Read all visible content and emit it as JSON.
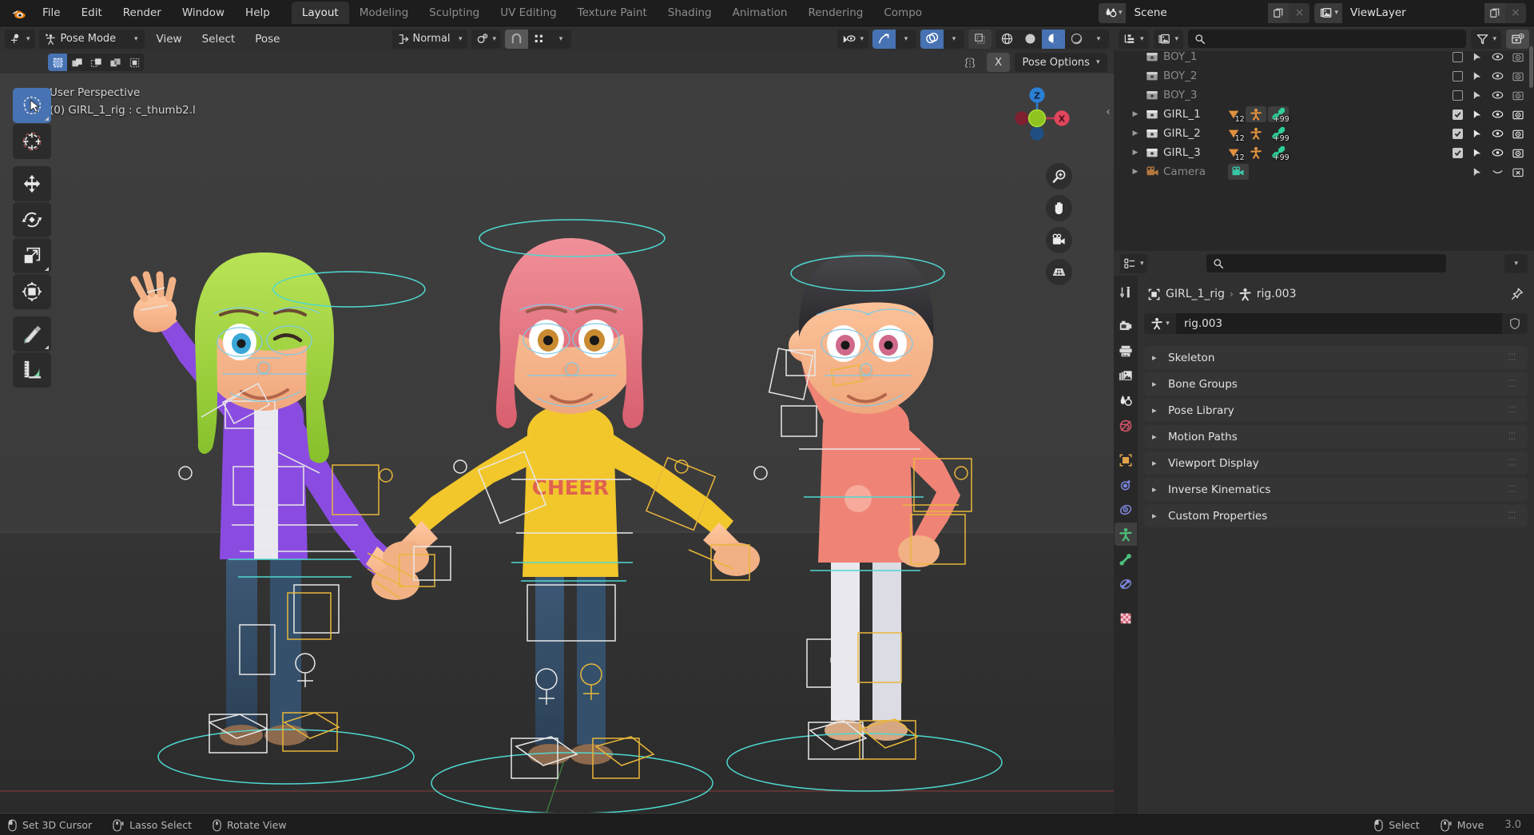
{
  "app": {
    "name": "Blender",
    "version": "3.0"
  },
  "topbar": {
    "menus": [
      "File",
      "Edit",
      "Render",
      "Window",
      "Help"
    ],
    "workspaces": [
      {
        "label": "Layout",
        "active": true
      },
      {
        "label": "Modeling",
        "active": false
      },
      {
        "label": "Sculpting",
        "active": false
      },
      {
        "label": "UV Editing",
        "active": false
      },
      {
        "label": "Texture Paint",
        "active": false
      },
      {
        "label": "Shading",
        "active": false
      },
      {
        "label": "Animation",
        "active": false
      },
      {
        "label": "Rendering",
        "active": false
      },
      {
        "label": "Compo",
        "active": false
      }
    ],
    "scene": {
      "name": "Scene",
      "icon": "scene-icon",
      "new_label": "",
      "x_label": "×"
    },
    "viewlayer": {
      "name": "ViewLayer",
      "icon": "viewlayer-icon",
      "x_label": "×"
    }
  },
  "viewport_header": {
    "editor_type_icon": "editor-type-icon",
    "mode": "Pose Mode",
    "menus": [
      "View",
      "Select",
      "Pose"
    ],
    "transform_orientation": "Normal",
    "pivot_icon": "pivot-point-icon",
    "snap_icon": "magnet-icon",
    "snap_target_icon": "snap-target-icon",
    "proportional_icon": "proportional-edit-icon",
    "visibility_icon": "object-visibility-icon",
    "gizmo_icon": "gizmo-icon",
    "overlays_icon": "overlays-icon",
    "xray_icon": "xray-icon",
    "shading": [
      "wireframe",
      "solid",
      "material-preview",
      "rendered"
    ],
    "shading_active": "material-preview"
  },
  "viewport_subheader": {
    "select_modes": [
      "set",
      "extend",
      "subtract",
      "invert",
      "intersect"
    ],
    "select_mode_active": 0,
    "symmetry_label": "X",
    "pose_options": "Pose Options"
  },
  "viewport": {
    "perspective_label": "User Perspective",
    "object_label": "(0) GIRL_1_rig : c_thumb2.l",
    "gizmo_axes": [
      {
        "name": "Z",
        "label": "Z",
        "color": "#2b7fd4"
      },
      {
        "name": "X",
        "label": "X",
        "color": "#d6374b"
      },
      {
        "name": "Y",
        "label": "",
        "color": "#8fc31f"
      }
    ],
    "nav_buttons": [
      "zoom-icon",
      "pan-hand-icon",
      "camera-view-icon",
      "toggle-perspective-icon"
    ],
    "tools": [
      {
        "name": "tweak-select-box-tool",
        "icon": "cursor-select-icon",
        "active": true
      },
      {
        "name": "cursor-tool",
        "icon": "3d-cursor-icon",
        "active": false
      },
      {
        "name": "move-tool",
        "icon": "move-arrows-icon",
        "active": false
      },
      {
        "name": "rotate-tool",
        "icon": "rotate-icon",
        "active": false
      },
      {
        "name": "scale-tool",
        "icon": "scale-icon",
        "active": false
      },
      {
        "name": "transform-tool",
        "icon": "transform-icon",
        "active": false
      },
      {
        "name": "annotate-tool",
        "icon": "pencil-icon",
        "active": false
      },
      {
        "name": "measure-tool",
        "icon": "ruler-icon",
        "active": false
      }
    ]
  },
  "outliner": {
    "display_mode_icon": "outliner-display-mode-icon",
    "filter_id_icon": "id-type-filter-icon",
    "search_placeholder": "",
    "search_value": "",
    "filter_icon": "funnel-icon",
    "new_collection_icon": "new-collection-icon",
    "rows": [
      {
        "name": "BOY_1",
        "dim": true,
        "expandable": false,
        "checkbox": "off",
        "badges": [],
        "rightmost": "camera"
      },
      {
        "name": "BOY_2",
        "dim": true,
        "expandable": false,
        "checkbox": "off",
        "badges": [],
        "rightmost": "camera"
      },
      {
        "name": "BOY_3",
        "dim": true,
        "expandable": false,
        "checkbox": "off",
        "badges": [],
        "rightmost": "camera"
      },
      {
        "name": "GIRL_1",
        "dim": false,
        "expandable": true,
        "checkbox": "on",
        "badges": [
          {
            "icon": "mesh-data-icon",
            "count": "12",
            "hl": false
          },
          {
            "icon": "armature-icon",
            "count": "",
            "hl": true
          },
          {
            "icon": "bone-icon",
            "count": "+99",
            "hl": true
          }
        ],
        "rightmost": "camera"
      },
      {
        "name": "GIRL_2",
        "dim": false,
        "expandable": true,
        "checkbox": "on",
        "badges": [
          {
            "icon": "mesh-data-icon",
            "count": "12",
            "hl": false
          },
          {
            "icon": "armature-icon",
            "count": "",
            "hl": false
          },
          {
            "icon": "bone-icon",
            "count": "+99",
            "hl": false
          }
        ],
        "rightmost": "camera"
      },
      {
        "name": "GIRL_3",
        "dim": false,
        "expandable": true,
        "checkbox": "on",
        "badges": [
          {
            "icon": "mesh-data-icon",
            "count": "12",
            "hl": false
          },
          {
            "icon": "armature-icon",
            "count": "",
            "hl": false
          },
          {
            "icon": "bone-icon",
            "count": "+99",
            "hl": false
          }
        ],
        "rightmost": "camera"
      },
      {
        "name": "Camera",
        "dim": true,
        "expandable": true,
        "checkbox": "none",
        "badges": [
          {
            "icon": "camera-data-icon",
            "count": "",
            "hl": true
          }
        ],
        "rightmost": "camera-off"
      }
    ]
  },
  "properties": {
    "editor_icon": "properties-editor-icon",
    "search_placeholder": "",
    "search_value": "",
    "breadcrumb": {
      "object_icon": "object-icon",
      "object": "GIRL_1_rig",
      "separator": "›",
      "data_icon": "armature-data-icon",
      "data": "rig.003",
      "pin_icon": "pin-icon"
    },
    "datablock": {
      "icon": "armature-data-icon",
      "name": "rig.003",
      "shield_icon": "fake-user-shield-icon"
    },
    "tabs": [
      {
        "name": "tool-tab",
        "icon": "tool-icon",
        "active": false,
        "color": "#d8d8d8"
      },
      {
        "name": "render-tab",
        "icon": "render-camera-icon",
        "active": false,
        "color": "#d8d8d8"
      },
      {
        "name": "output-tab",
        "icon": "printer-icon",
        "active": false,
        "color": "#d8d8d8"
      },
      {
        "name": "view-layer-tab",
        "icon": "images-icon",
        "active": false,
        "color": "#d8d8d8"
      },
      {
        "name": "scene-tab",
        "icon": "scene-cone-icon",
        "active": false,
        "color": "#d8d8d8"
      },
      {
        "name": "world-tab",
        "icon": "world-globe-icon",
        "active": false,
        "color": "#d4536a"
      },
      {
        "name": "object-tab",
        "icon": "object-square-icon",
        "active": false,
        "color": "#e0a24a"
      },
      {
        "name": "modifiers-tab",
        "icon": "physics-orbit-icon",
        "active": false,
        "color": "#7b85d8"
      },
      {
        "name": "constraints-tab",
        "icon": "constraint-icon",
        "active": false,
        "color": "#7b85d8"
      },
      {
        "name": "object-data-tab",
        "icon": "armature-data-icon",
        "active": true,
        "color": "#4ec07c"
      },
      {
        "name": "bone-tab",
        "icon": "bone-icon",
        "active": false,
        "color": "#4ec07c"
      },
      {
        "name": "bone-constraint-tab",
        "icon": "bone-constraint-icon",
        "active": false,
        "color": "#7b85d8"
      },
      {
        "name": "texture-tab",
        "icon": "checker-texture-icon",
        "active": false,
        "color": "#d4687a"
      }
    ],
    "panels": [
      {
        "label": "Skeleton",
        "expanded": false
      },
      {
        "label": "Bone Groups",
        "expanded": false
      },
      {
        "label": "Pose Library",
        "expanded": false
      },
      {
        "label": "Motion Paths",
        "expanded": false
      },
      {
        "label": "Viewport Display",
        "expanded": false
      },
      {
        "label": "Inverse Kinematics",
        "expanded": false
      },
      {
        "label": "Custom Properties",
        "expanded": false
      }
    ]
  },
  "statusbar": {
    "items": [
      {
        "mouse": "left",
        "label": "Set 3D Cursor"
      },
      {
        "mouse": "middle-drag",
        "label": "Lasso Select"
      },
      {
        "mouse": "middle",
        "label": "Rotate View"
      }
    ],
    "right_items": [
      {
        "mouse": "left",
        "label": "Select"
      },
      {
        "mouse": "middle-drag",
        "label": "Move"
      }
    ],
    "version": "3.0"
  },
  "colors": {
    "accent_blue": "#4772b3",
    "panel_bg": "#303030",
    "editor_bg": "#282828",
    "viewport_top": "#3b3b3b",
    "bone_yellow": "#e8b73a",
    "bone_cyan": "#4fd8d0",
    "bone_white": "#e8e8e8"
  }
}
